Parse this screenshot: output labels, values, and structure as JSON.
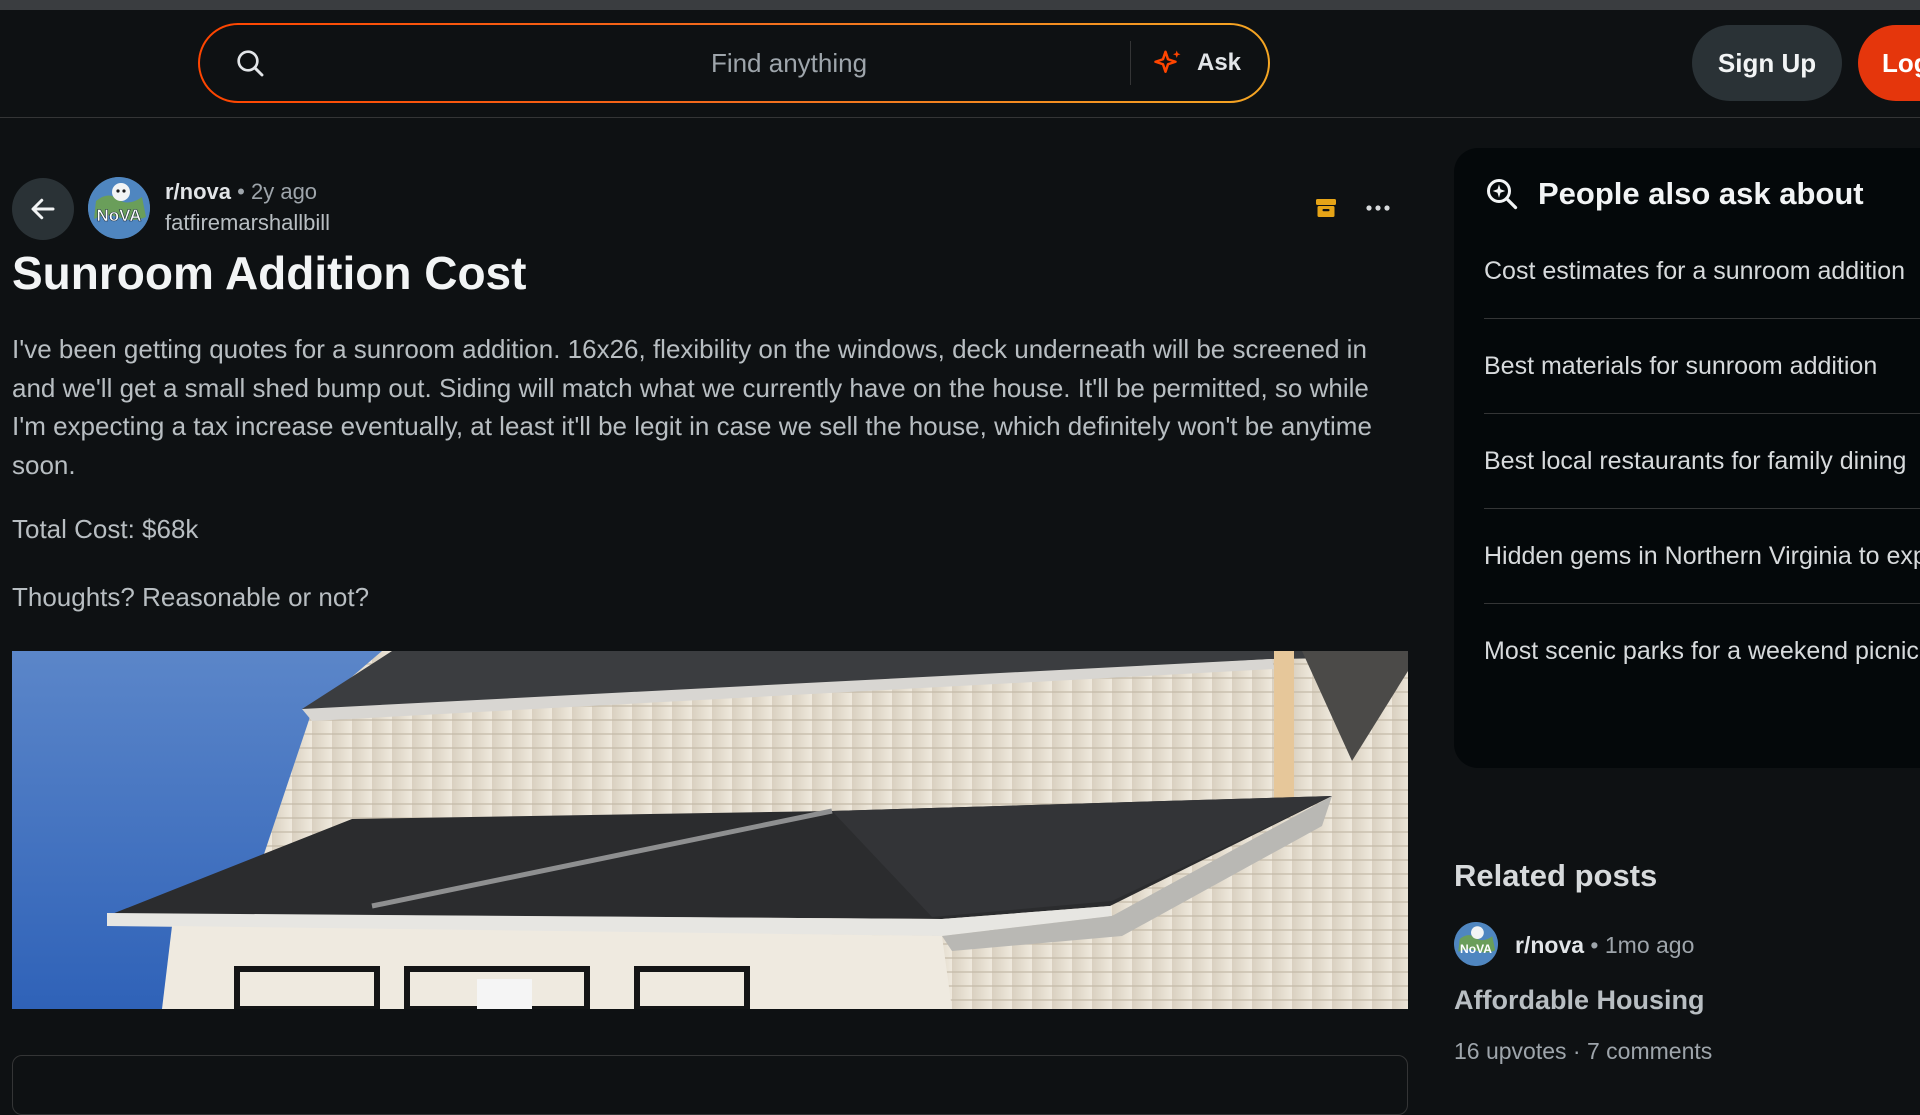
{
  "header": {
    "search_placeholder": "Find anything",
    "ask_label": "Ask",
    "signup_label": "Sign Up",
    "login_label": "Log In"
  },
  "post": {
    "subreddit": "r/nova",
    "age": "2y ago",
    "author": "fatfiremarshallbill",
    "avatar_text": "NoVA",
    "title": "Sunroom Addition Cost",
    "body": "I've been getting quotes for a sunroom addition. 16x26, flexibility on the windows, deck underneath will be screened in and we'll get a small shed bump out. Siding will match what we currently have on the house. It'll be permitted, so while I'm expecting a tax increase eventually, at least it'll be legit in case we sell the house, which definitely won't be anytime soon.",
    "total_cost": "Total Cost: $68k",
    "question": "Thoughts? Reasonable or not?"
  },
  "sidebar": {
    "ask_title": "People also ask about",
    "questions": [
      "Cost estimates for a sunroom addition",
      "Best materials for sunroom addition",
      "Best local restaurants for family dining",
      "Hidden gems in Northern Virginia to explore",
      "Most scenic parks for a weekend picnic"
    ],
    "related_title": "Related posts",
    "related": {
      "subreddit": "r/nova",
      "age": "1mo ago",
      "title": "Affordable Housing",
      "upvotes": "16 upvotes",
      "comments": "7 comments"
    }
  },
  "colors": {
    "background": "#0e1113",
    "accent": "#ff4500",
    "panel": "#04080a"
  }
}
